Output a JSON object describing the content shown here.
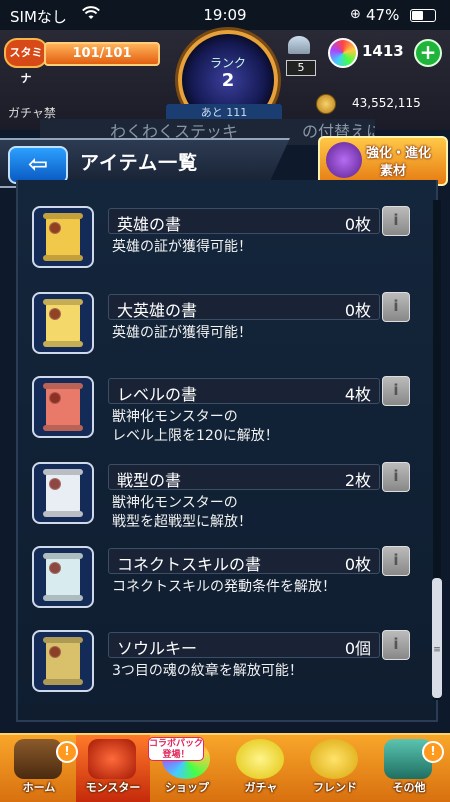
{
  "status_bar": {
    "carrier": "SIMなし",
    "time": "19:09",
    "battery": "47%"
  },
  "header": {
    "stamina_label": "スタミナ",
    "stamina_value": "101/101",
    "rank_label": "ランク",
    "rank_value": "2",
    "box_count": "5",
    "orb_count": "1413",
    "gacha_ban": "ガチャ禁",
    "next_rank": "あと 111",
    "coin_count": "43,552,115"
  },
  "title_bar": {
    "ghost_text": "わくわくステッキ　　　　の付替えに使用！",
    "back_arrow": "⇦",
    "title": "アイテム一覧",
    "evolve_label_top": "強化・進化",
    "evolve_label_bottom": "素材"
  },
  "items": [
    {
      "name": "英雄の書",
      "count": "0枚",
      "desc": "英雄の証が獲得可能！",
      "color": "#f2c84a"
    },
    {
      "name": "大英雄の書",
      "count": "0枚",
      "desc": "英雄の証が獲得可能！",
      "color": "#f5d86a"
    },
    {
      "name": "レベルの書",
      "count": "4枚",
      "desc": "獣神化モンスターの\nレベル上限を120に解放！",
      "color": "#e97a6a"
    },
    {
      "name": "戦型の書",
      "count": "2枚",
      "desc": "獣神化モンスターの\n戦型を超戦型に解放！",
      "color": "#e9eef5"
    },
    {
      "name": "コネクトスキルの書",
      "count": "0枚",
      "desc": "コネクトスキルの発動条件を解放！",
      "color": "#d8ecef"
    },
    {
      "name": "ソウルキー",
      "count": "0個",
      "desc": "3つ目の魂の紋章を解放可能！",
      "color": "#d9c06a"
    }
  ],
  "info_glyph": "i",
  "bottom_nav": [
    {
      "label": "ホーム"
    },
    {
      "label": "モンスター"
    },
    {
      "label": "ショップ"
    },
    {
      "label": "ガチャ"
    },
    {
      "label": "フレンド"
    },
    {
      "label": "その他"
    }
  ],
  "collab_badge": "コラボパック\n登場！",
  "notice": "!"
}
